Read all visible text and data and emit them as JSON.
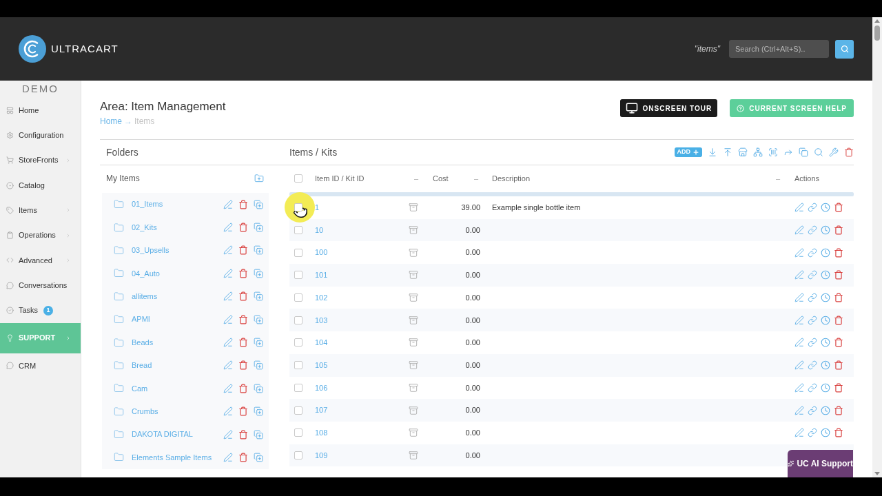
{
  "header": {
    "logo_text": "ULTRACART",
    "search_scope": "\"items\"",
    "search": {
      "placeholder": "Search (Ctrl+Alt+S).."
    }
  },
  "sidebar": {
    "account": "DEMO",
    "items": [
      {
        "label": "Home",
        "submenu": false,
        "selected": false
      },
      {
        "label": "Configuration",
        "submenu": false,
        "selected": false
      },
      {
        "label": "StoreFronts",
        "submenu": true,
        "selected": false
      },
      {
        "label": "Catalog",
        "submenu": false,
        "selected": false
      },
      {
        "label": "Items",
        "submenu": true,
        "selected": false
      },
      {
        "label": "Operations",
        "submenu": true,
        "selected": false
      },
      {
        "label": "Advanced",
        "submenu": true,
        "selected": false
      },
      {
        "label": "Conversations",
        "submenu": false,
        "selected": false
      },
      {
        "label": "Tasks",
        "submenu": false,
        "selected": false,
        "badge": "1"
      },
      {
        "label": "SUPPORT",
        "submenu": true,
        "selected": true
      },
      {
        "label": "CRM",
        "submenu": false,
        "selected": false
      }
    ]
  },
  "page": {
    "title": "Area: Item Management",
    "breadcrumb": {
      "separator": "→",
      "items": [
        {
          "label": "Home",
          "link": true
        },
        {
          "label": "Items",
          "link": false
        }
      ]
    },
    "buttons": [
      {
        "label": "ONSCREEN TOUR",
        "kind": "tour"
      },
      {
        "label": "CURRENT SCREEN HELP",
        "kind": "help"
      }
    ]
  },
  "folders": {
    "title": "Folders",
    "group": "My Items",
    "items": [
      "01_Items",
      "02_Kits",
      "03_Upsells",
      "04_Auto",
      "allitems",
      "APMI",
      "Beads",
      "Bread",
      "Cam",
      "Crumbs",
      "DAKOTA DIGITAL",
      "Elements Sample Items"
    ]
  },
  "items": {
    "title": "Items / Kits",
    "add_label": "ADD",
    "columns": [
      {
        "label": "Item ID / Kit ID",
        "sort_mark": "–"
      },
      {
        "label": "Cost",
        "sort_mark": "–"
      },
      {
        "label": "Description",
        "sort_mark": "–"
      },
      {
        "label": "Actions"
      }
    ],
    "select_all": {
      "checked": false
    },
    "rows": [
      {
        "id": "1",
        "cost": "39.00",
        "description": "Example single bottle item",
        "checked": false
      },
      {
        "id": "10",
        "cost": "0.00",
        "checked": false
      },
      {
        "id": "100",
        "cost": "0.00",
        "checked": false
      },
      {
        "id": "101",
        "cost": "0.00",
        "checked": false
      },
      {
        "id": "102",
        "cost": "0.00",
        "checked": false
      },
      {
        "id": "103",
        "cost": "0.00",
        "checked": false
      },
      {
        "id": "104",
        "cost": "0.00",
        "checked": false
      },
      {
        "id": "105",
        "cost": "0.00",
        "checked": false
      },
      {
        "id": "106",
        "cost": "0.00",
        "checked": false
      },
      {
        "id": "107",
        "cost": "0.00",
        "checked": false
      },
      {
        "id": "108",
        "cost": "0.00",
        "checked": false
      },
      {
        "id": "109",
        "cost": "0.00",
        "checked": false
      }
    ]
  },
  "chat": {
    "label": "UC AI Support"
  }
}
